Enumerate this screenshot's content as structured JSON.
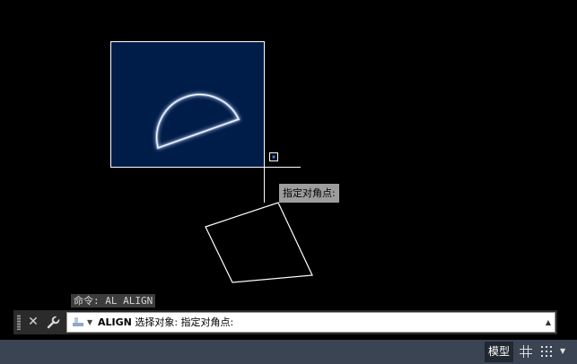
{
  "canvas": {
    "background": "#000000",
    "selection_fill": "#001d4a",
    "stroke_color": "#ffffff",
    "glow_color": "#8fb6ff"
  },
  "tooltip": {
    "text": "指定对角点:"
  },
  "command_history": {
    "text": "命令: AL ALIGN"
  },
  "command_line": {
    "close_icon": "close-icon",
    "customize_icon": "wrench-icon",
    "command": "ALIGN",
    "prompt": "选择对象: 指定对角点:"
  },
  "status_bar": {
    "model_tab": "模型",
    "grid_icon": "grid-icon",
    "snap_icon": "snap-dots-icon"
  }
}
